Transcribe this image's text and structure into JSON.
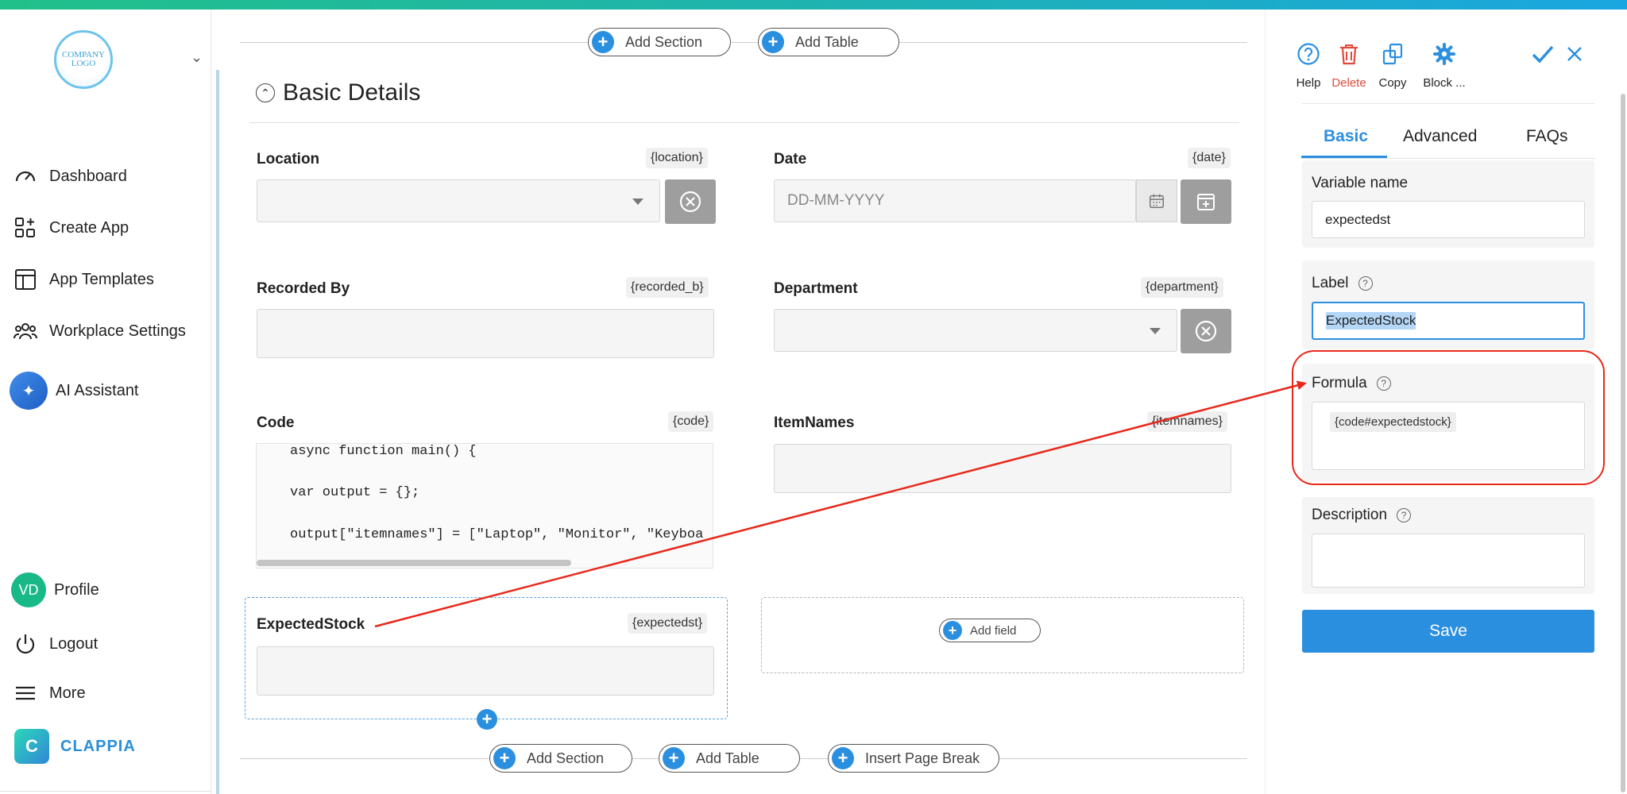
{
  "sidebar": {
    "logo_text": "COMPANY LOGO",
    "nav": [
      {
        "label": "Dashboard",
        "icon": "dashboard-icon"
      },
      {
        "label": "Create App",
        "icon": "create-app-icon"
      },
      {
        "label": "App Templates",
        "icon": "templates-icon"
      },
      {
        "label": "Workplace Settings",
        "icon": "users-icon"
      },
      {
        "label": "AI Assistant",
        "icon": "ai-assistant-icon"
      }
    ],
    "profile": {
      "initials": "VD",
      "label": "Profile"
    },
    "logout_label": "Logout",
    "more_label": "More",
    "brand": "CLAPPIA"
  },
  "canvas": {
    "top_actions": {
      "add_section": "Add Section",
      "add_table": "Add Table"
    },
    "section_title": "Basic Details",
    "fields": {
      "location": {
        "label": "Location",
        "tag": "{location}"
      },
      "date": {
        "label": "Date",
        "tag": "{date}",
        "placeholder": "DD-MM-YYYY"
      },
      "recorded_by": {
        "label": "Recorded By",
        "tag": "{recorded_b}"
      },
      "department": {
        "label": "Department",
        "tag": "{department}"
      },
      "code": {
        "label": "Code",
        "tag": "{code}",
        "lines": [
          "async function main() {",
          "var output = {};",
          "output[\"itemnames\"] = [\"Laptop\", \"Monitor\", \"Keyboa"
        ]
      },
      "itemnames": {
        "label": "ItemNames",
        "tag": "{itemnames}"
      },
      "expectedstock": {
        "label": "ExpectedStock",
        "tag": "{expectedst}"
      }
    },
    "add_field": "Add field",
    "bottom_actions": {
      "add_section": "Add Section",
      "add_table": "Add Table",
      "insert_page_break": "Insert Page Break"
    }
  },
  "panel": {
    "tools": {
      "help": "Help",
      "delete": "Delete",
      "copy": "Copy",
      "block": "Block ..."
    },
    "tabs": [
      "Basic",
      "Advanced",
      "FAQs"
    ],
    "active_tab": "Basic",
    "variable_name": {
      "label": "Variable name",
      "value": "expectedst"
    },
    "label_field": {
      "label": "Label",
      "value": "ExpectedStock"
    },
    "formula": {
      "label": "Formula",
      "value": "{code#expectedstock}"
    },
    "description": {
      "label": "Description",
      "value": ""
    },
    "save": "Save"
  },
  "colors": {
    "accent": "#2b8fe0",
    "danger": "#e04a3b",
    "annotation": "#e8281a",
    "brand": "#2a8fd9"
  }
}
